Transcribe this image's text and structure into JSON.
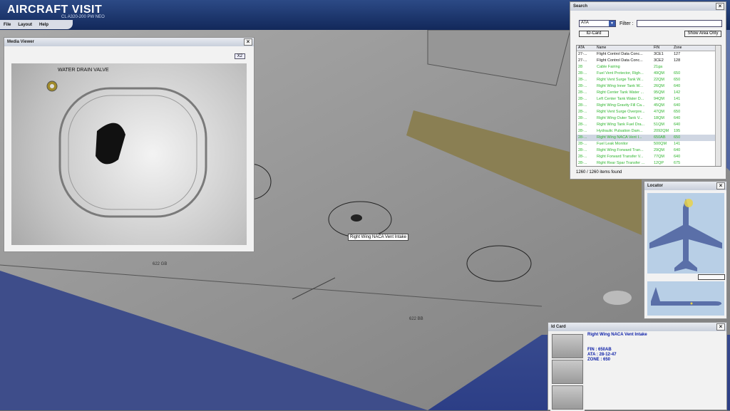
{
  "app": {
    "title": "AIRCRAFT VISIT",
    "subtitle": "CL A320-200 PW NEO",
    "menu": [
      "File",
      "Layout",
      "Help"
    ]
  },
  "media_viewer": {
    "title": "Media Viewer",
    "x2_label": "X2",
    "photo_label": "WATER DRAIN VALVE"
  },
  "search": {
    "title": "Search",
    "selected_filter": "ATA",
    "filter_label": "Filter :",
    "id_card_button": "ID-Card",
    "show_area_button": "Show Area Only",
    "columns": [
      "ATA",
      "Name",
      "FIN",
      "Zone"
    ],
    "rows": [
      {
        "ata": "27-...",
        "name": "Flight Control Data Conc...",
        "fin": "3CE1",
        "zone": "127"
      },
      {
        "ata": "27-...",
        "name": "Flight Control Data Conc...",
        "fin": "3CE2",
        "zone": "128"
      },
      {
        "ata": "28",
        "name": "Cable Fairing",
        "fin": "21ga",
        "zone": ""
      },
      {
        "ata": "28-...",
        "name": "Fuel Vent Protector, Righ...",
        "fin": "49QM",
        "zone": "650"
      },
      {
        "ata": "28-...",
        "name": "Right Vent Surge Tank W...",
        "fin": "22QM",
        "zone": "650"
      },
      {
        "ata": "28-...",
        "name": "Right Wing Inner Tank W...",
        "fin": "26QM",
        "zone": "640"
      },
      {
        "ata": "28-...",
        "name": "Right Center Tank Water ...",
        "fin": "95QM",
        "zone": "142"
      },
      {
        "ata": "28-...",
        "name": "Left Center Tank Water D...",
        "fin": "94QM",
        "zone": "141"
      },
      {
        "ata": "28-...",
        "name": "Right Wing Gravity Fill Ca...",
        "fin": "45QM",
        "zone": "640"
      },
      {
        "ata": "28-...",
        "name": "Right Vent Surge Overpre...",
        "fin": "47QM",
        "zone": "650"
      },
      {
        "ata": "28-...",
        "name": "Right Wing Outer Tank V...",
        "fin": "18QM",
        "zone": "640"
      },
      {
        "ata": "28-...",
        "name": "Right Wing Tank Fuel Dra...",
        "fin": "51QM",
        "zone": "640"
      },
      {
        "ata": "28-...",
        "name": "Hydraulic Pulsation Dam...",
        "fin": "2092QM",
        "zone": "195"
      },
      {
        "ata": "28-...",
        "name": "Right Wing NACA Vent I...",
        "fin": "650AB",
        "zone": "650",
        "selected": true
      },
      {
        "ata": "28-...",
        "name": "Fuel Leak Monitor",
        "fin": "500QM",
        "zone": "141"
      },
      {
        "ata": "28-...",
        "name": "Right Wing Forward Tran...",
        "fin": "29QM",
        "zone": "640"
      },
      {
        "ata": "28-...",
        "name": "Right Forward Transfer V...",
        "fin": "77QM",
        "zone": "640"
      },
      {
        "ata": "28-...",
        "name": "Right Rear Spar Transfer ...",
        "fin": "12QP",
        "zone": "675"
      }
    ],
    "items_found": "1260 / 1260 items found"
  },
  "locator": {
    "title": "Locator"
  },
  "id_card": {
    "title": "Id Card",
    "item_name": "Right Wing NACA Vent Intake",
    "fin": "FIN : 650AB",
    "ata": "ATA : 28-12-47",
    "zone": "ZONE : 650"
  },
  "scene": {
    "tooltip": "Right Wing NACA Vent Intake",
    "wing_marks": [
      "622 GB",
      "622 BB"
    ]
  },
  "colors": {
    "title_bar": "#12285a",
    "green_row": "#2fb52f",
    "dark_row": "#111111",
    "selected_row_bg": "#cfd6e2",
    "id_text": "#0d20a8"
  }
}
